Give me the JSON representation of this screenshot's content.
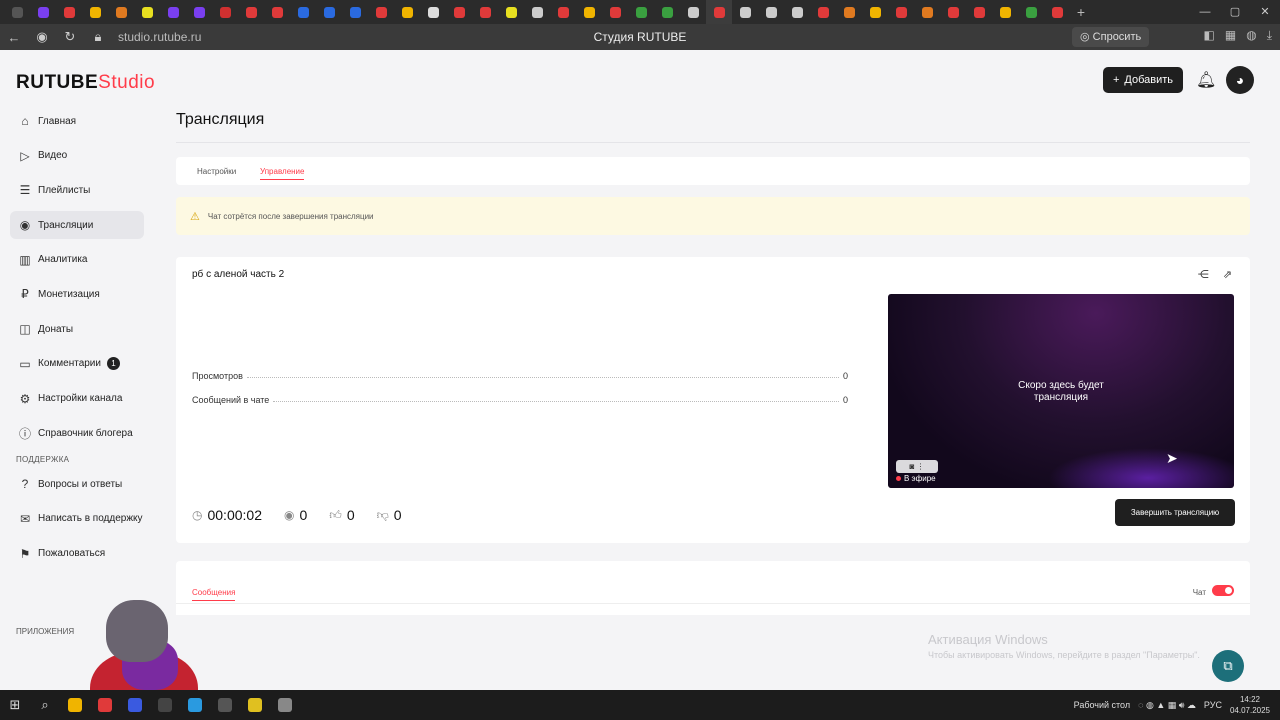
{
  "browser": {
    "tab_colors": [
      "#555",
      "#7a3ff0",
      "#e03a3a",
      "#f0b400",
      "#e07a20",
      "#e8e020",
      "#7a3ff0",
      "#7a3ff0",
      "#d03030",
      "#e03a3a",
      "#e03a3a",
      "#2a6ae0",
      "#2a6ae0",
      "#2a6ae0",
      "#e03a3a",
      "#f0b400",
      "#dddddd",
      "#e03a3a",
      "#e03a3a",
      "#e8e020",
      "#cccccc",
      "#e03a3a",
      "#f0b400",
      "#e03a3a",
      "#3aa040",
      "#3aa040",
      "#cccccc",
      "#e03a3a",
      "#cccccc",
      "#cccccc",
      "#cccccc",
      "#e03a3a",
      "#e07a20",
      "#f0b400",
      "#e03a3a",
      "#e07a20",
      "#e03a3a",
      "#e03a3a",
      "#f0b400",
      "#3aa040",
      "#e03a3a"
    ],
    "url": "studio.rutube.ru",
    "title": "Студия RUTUBE",
    "ask_label": "Спросить"
  },
  "app": {
    "logo_main": "RUTUBE",
    "logo_studio": "Studio",
    "add_label": "Добавить"
  },
  "sidebar": {
    "items": [
      {
        "label": "Главная",
        "icon": "home-icon",
        "glyph": "⌂"
      },
      {
        "label": "Видео",
        "icon": "video-icon",
        "glyph": "▷"
      },
      {
        "label": "Плейлисты",
        "icon": "playlist-icon",
        "glyph": "☰"
      },
      {
        "label": "Трансляции",
        "icon": "broadcast-icon",
        "glyph": "◉"
      },
      {
        "label": "Аналитика",
        "icon": "analytics-icon",
        "glyph": "▥"
      },
      {
        "label": "Монетизация",
        "icon": "monetization-icon",
        "glyph": "₽"
      },
      {
        "label": "Донаты",
        "icon": "donate-icon",
        "glyph": "◫"
      },
      {
        "label": "Комментарии",
        "icon": "comments-icon",
        "glyph": "▭",
        "badge": "1"
      },
      {
        "label": "Настройки канала",
        "icon": "settings-icon",
        "glyph": "⚙"
      },
      {
        "label": "Справочник блогера",
        "icon": "help-icon",
        "glyph": "ⓘ"
      }
    ],
    "support_section": "ПОДДЕРЖКА",
    "support_items": [
      {
        "label": "Вопросы и ответы",
        "icon": "faq-icon",
        "glyph": "?"
      },
      {
        "label": "Написать в поддержку",
        "icon": "mail-icon",
        "glyph": "✉"
      },
      {
        "label": "Пожаловаться",
        "icon": "flag-icon",
        "glyph": "⚑"
      }
    ],
    "apps_section": "ПРИЛОЖЕНИЯ"
  },
  "page": {
    "heading": "Трансляция",
    "tabs": [
      "Настройки",
      "Управление"
    ],
    "warning": "Чат сотрётся после завершения трансляции",
    "stream_title": "рб с аленой часть 2",
    "stats": [
      {
        "label": "Просмотров",
        "value": "0"
      },
      {
        "label": "Сообщений в чате",
        "value": "0"
      }
    ],
    "counters": {
      "duration": "00:00:02",
      "viewers": "0",
      "likes": "0",
      "dislikes": "0"
    },
    "preview_line1": "Скоро здесь будет",
    "preview_line2": "трансляция",
    "live_label": "В эфире",
    "end_button": "Завершить трансляцию",
    "messages_tab": "Сообщения",
    "chat_label": "Чат",
    "chat_enabled": true
  },
  "os": {
    "watermark_title": "Активация Windows",
    "watermark_sub": "Чтобы активировать Windows, перейдите в раздел \"Параметры\".",
    "desktop_label": "Рабочий стол",
    "lang": "РУС",
    "time": "14:22",
    "date": "04.07.2025"
  }
}
